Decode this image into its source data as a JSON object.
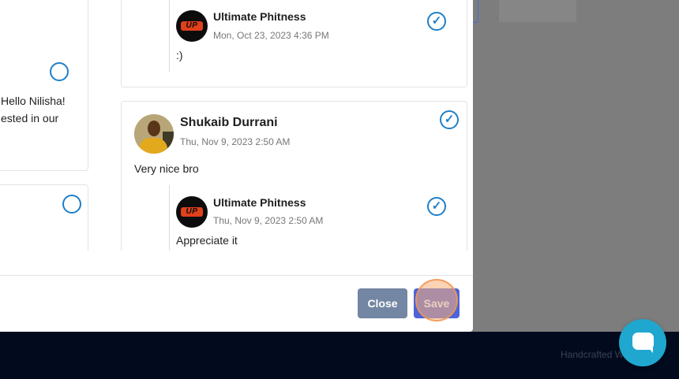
{
  "footer": {
    "text": "Handcrafted W"
  },
  "left_column": {
    "card1": {
      "message_line1": "Hello Nilisha!",
      "message_line2": "ested in our"
    }
  },
  "thread1": {
    "reply": {
      "author": "Ultimate Phitness",
      "date": "Mon, Oct 23, 2023 4:36 PM",
      "message": ":)"
    }
  },
  "thread2": {
    "author": "Shukaib Durrani",
    "date": "Thu, Nov 9, 2023 2:50 AM",
    "message": "Very nice bro",
    "reply": {
      "author": "Ultimate Phitness",
      "date": "Thu, Nov 9, 2023 2:50 AM",
      "message": "Appreciate it"
    }
  },
  "logo_text": "UP",
  "check_glyph": "✓",
  "buttons": {
    "close": "Close",
    "save": "Save"
  },
  "colors": {
    "accent": "#1e7fc9",
    "save": "#4d64d8",
    "close": "#7386a3",
    "footer": "#020b1e",
    "chat": "#1fa7cf"
  }
}
